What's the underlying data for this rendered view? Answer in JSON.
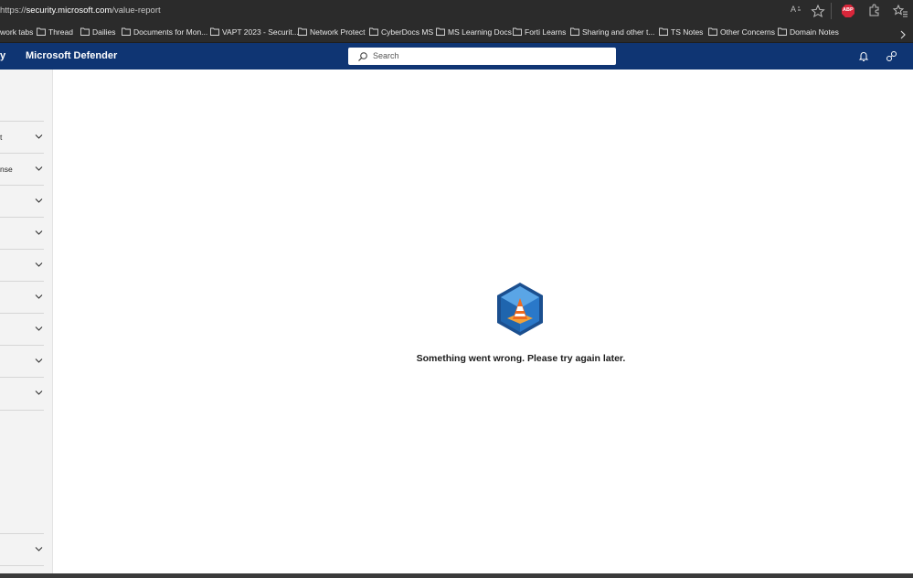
{
  "browser": {
    "url_scheme": "https://",
    "url_host": "security.microsoft.com",
    "url_path": "/value-report",
    "reader_label": "A",
    "extension_badge": "ABP"
  },
  "bookmarks": [
    "work tabs",
    "Thread",
    "Dailies",
    "Documents for Mon...",
    "VAPT 2023 - Securit...",
    "Network Protect",
    "CyberDocs MS",
    "MS Learning Docs",
    "Forti Learns",
    "Sharing and other t...",
    "TS Notes",
    "Other Concerns",
    "Domain Notes"
  ],
  "app": {
    "left_fragment": "y",
    "title": "Microsoft Defender",
    "search_placeholder": "Search"
  },
  "sidebar": {
    "items": [
      "t",
      "nse",
      "",
      "",
      "",
      "",
      "",
      "",
      "",
      ""
    ]
  },
  "main": {
    "error_message": "Something went wrong. Please try again later."
  },
  "colors": {
    "appbar": "#0f3573",
    "chrome": "#2b2b2b",
    "hex_blue": "#1f6fbf",
    "cone_orange": "#f06a1e"
  }
}
